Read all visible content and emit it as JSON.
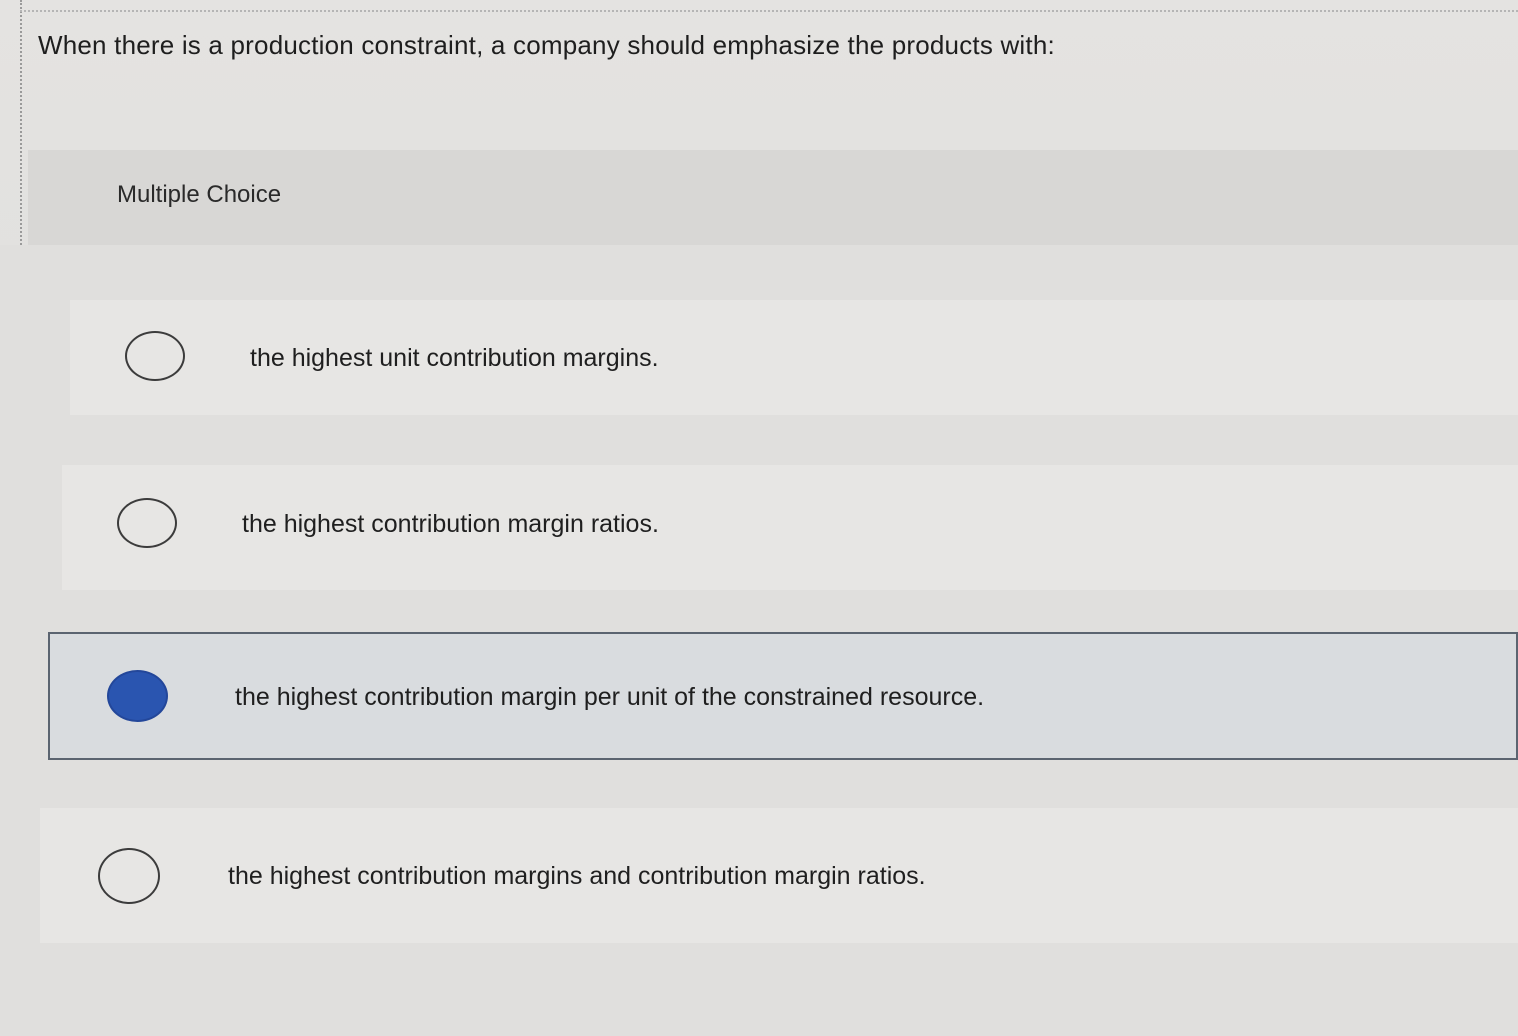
{
  "question": {
    "text": "When there is a production constraint, a company should emphasize the products with:"
  },
  "section": {
    "label": "Multiple Choice"
  },
  "options": [
    {
      "text": "the highest unit contribution margins.",
      "selected": false
    },
    {
      "text": "the highest contribution margin ratios.",
      "selected": false
    },
    {
      "text": "the highest contribution margin per unit of the constrained resource.",
      "selected": true
    },
    {
      "text": "the highest contribution margins and contribution margin ratios.",
      "selected": false
    }
  ],
  "colors": {
    "selected_radio": "#2a55b0",
    "selected_row_border": "#5b6470"
  }
}
